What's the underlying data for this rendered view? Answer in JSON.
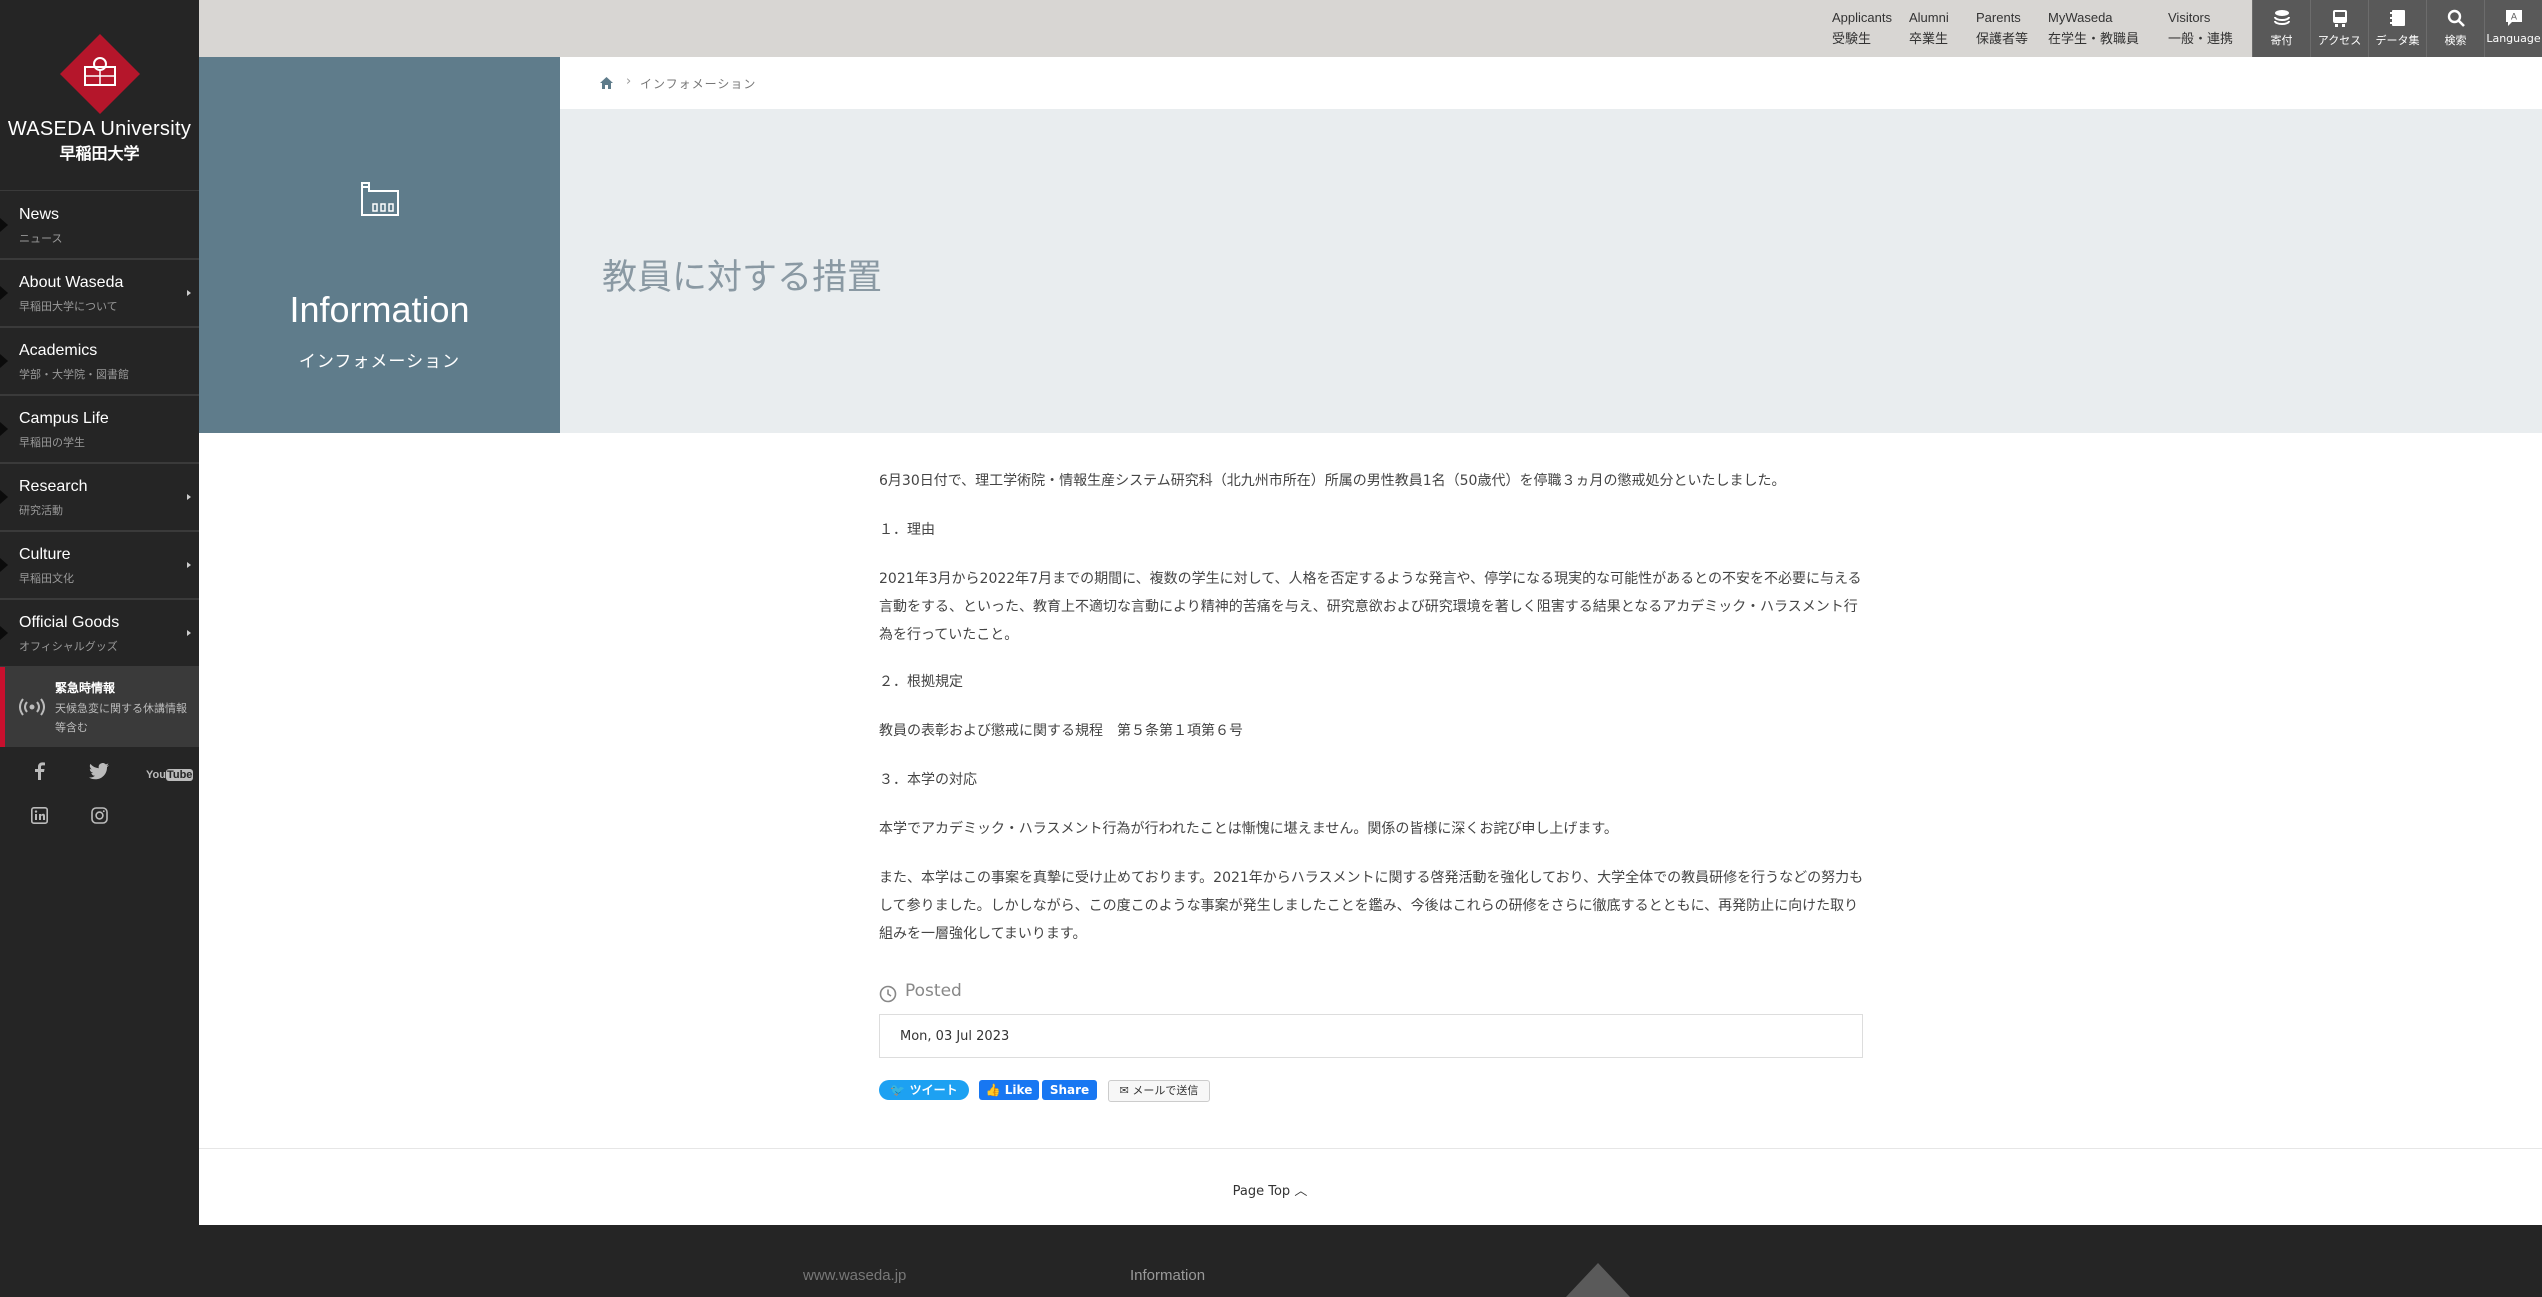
{
  "brand": {
    "name_en": "WASEDA University",
    "name_jp": "早稲田大学"
  },
  "sidebar": {
    "items": [
      {
        "en": "News",
        "jp": "ニュース",
        "arrow": false
      },
      {
        "en": "About Waseda",
        "jp": "早稲田大学について",
        "arrow": true
      },
      {
        "en": "Academics",
        "jp": "学部・大学院・図書館",
        "arrow": false
      },
      {
        "en": "Campus Life",
        "jp": "早稲田の学生",
        "arrow": false
      },
      {
        "en": "Research",
        "jp": "研究活動",
        "arrow": true
      },
      {
        "en": "Culture",
        "jp": "早稲田文化",
        "arrow": true
      },
      {
        "en": "Official Goods",
        "jp": "オフィシャルグッズ",
        "arrow": true
      }
    ],
    "emergency": {
      "title": "緊急時情報",
      "desc": "天候急変に関する休講情報等含む"
    },
    "social": [
      "facebook-icon",
      "twitter-icon",
      "youtube-icon",
      "linkedin-icon",
      "instagram-icon"
    ]
  },
  "topnav": {
    "links": [
      {
        "en": "Applicants",
        "jp": "受験生"
      },
      {
        "en": "Alumni",
        "jp": "卒業生"
      },
      {
        "en": "Parents",
        "jp": "保護者等"
      },
      {
        "en": "MyWaseda",
        "jp": "在学生・教職員"
      },
      {
        "en": "Visitors",
        "jp": "一般・連携"
      }
    ],
    "icons": [
      {
        "name": "donation-icon",
        "label": "寄付"
      },
      {
        "name": "access-icon",
        "label": "アクセス"
      },
      {
        "name": "data-icon",
        "label": "データ集"
      },
      {
        "name": "search-icon",
        "label": "検索"
      },
      {
        "name": "language-icon",
        "label": "Language"
      }
    ]
  },
  "breadcrumb": {
    "current": "インフォメーション"
  },
  "hero": {
    "title_en": "Information",
    "title_jp": "インフォメーション",
    "heading": "教員に対する措置"
  },
  "article": {
    "paragraphs": [
      "6月30日付で、理工学術院・情報生産システム研究科（北九州市所在）所属の男性教員1名（50歳代）を停職３ヵ月の懲戒処分といたしました。",
      "１．理由",
      "2021年3月から2022年7月までの期間に、複数の学生に対して、人格を否定するような発言や、停学になる現実的な可能性があるとの不安を不必要に与える言動をする、といった、教育上不適切な言動により精神的苦痛を与え、研究意欲および研究環境を著しく阻害する結果となるアカデミック・ハラスメント行為を行っていたこと。",
      "２．根拠規定",
      "教員の表彰および懲戒に関する規程　第５条第１項第６号",
      "３．本学の対応",
      "本学でアカデミック・ハラスメント行為が行われたことは慚愧に堪えません。関係の皆様に深くお詫び申し上げます。",
      "また、本学はこの事案を真摯に受け止めております。2021年からハラスメントに関する啓発活動を強化しており、大学全体での教員研修を行うなどの努力もして参りました。しかしながら、この度このような事案が発生しましたことを鑑み、今後はこれらの研修をさらに徹底するとともに、再発防止に向けた取り組みを一層強化してまいります。"
    ],
    "posted_label": "Posted",
    "date": "Mon, 03 Jul 2023"
  },
  "share": {
    "tweet": "ツイート",
    "like": "Like",
    "share": "Share",
    "mail": "メールで送信"
  },
  "pagetop": "Page Top",
  "footer": {
    "link1": "www.waseda.jp",
    "link2": "Information"
  },
  "colors": {
    "accent": "#c8102e",
    "hero": "#5f7c8b",
    "sidebar": "#252525"
  }
}
